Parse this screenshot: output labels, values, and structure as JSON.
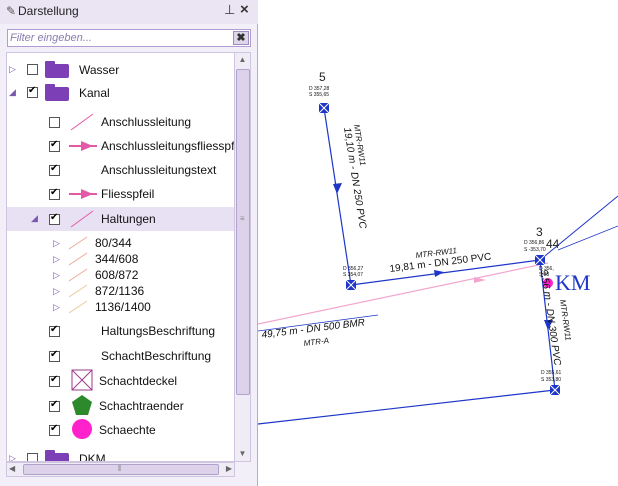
{
  "panel": {
    "title": "Darstellung",
    "pin_icon": "pin-icon",
    "close_icon": "close-icon",
    "filter_placeholder": "Filter eingeben...",
    "clear_label": "✖"
  },
  "tree": {
    "wasser": "Wasser",
    "kanal": "Kanal",
    "anschlussleitung": "Anschlussleitung",
    "anschlussleitungsfliesspfeil": "Anschlussleitungsfliesspfeil",
    "anschlussleitungstext": "Anschlussleitungstext",
    "fliesspfeil": "Fliesspfeil",
    "haltungen": "Haltungen",
    "range1": "80/344",
    "range2": "344/608",
    "range3": "608/872",
    "range4": "872/1136",
    "range5": "1136/1400",
    "haltungsbeschriftung": "HaltungsBeschriftung",
    "schachtbeschriftung": "SchachtBeschriftung",
    "schachtdeckel": "Schachtdeckel",
    "schachtraender": "Schachtraender",
    "schaechte": "Schaechte",
    "dkm": "DKM"
  },
  "map": {
    "node5": "5",
    "node5_d": "D 357,28",
    "node5_s": "S 355,65",
    "pipe1": "MTR-RW11",
    "pipe1_len": "19,10 m - DN 250 PVC",
    "node_mid_d": "D 356,27",
    "node_mid_s": "S 354,07",
    "pipe2": "MTR-RW11",
    "pipe2_len": "19,81 m - DN 250 PVC",
    "node3": "3",
    "node3_d": "D 356,86",
    "node3_s": "S -353,70",
    "node44": "44",
    "node44_d": "D 356,",
    "node44_s": "S 35",
    "km": "KM",
    "pipe3": "MTR-RW11",
    "pipe3_len": "9,56 m - DN 300 PVC",
    "pipe4_len": "49,75 m - DN 500 BMR",
    "pipe4": "MTR-A",
    "node_low_d": "D 355,61",
    "node_low_s": "S 353,80"
  },
  "colors": {
    "accent": "#7c3fb5",
    "pipe": "#1d36c8",
    "anschluss": "#e35aa8"
  }
}
